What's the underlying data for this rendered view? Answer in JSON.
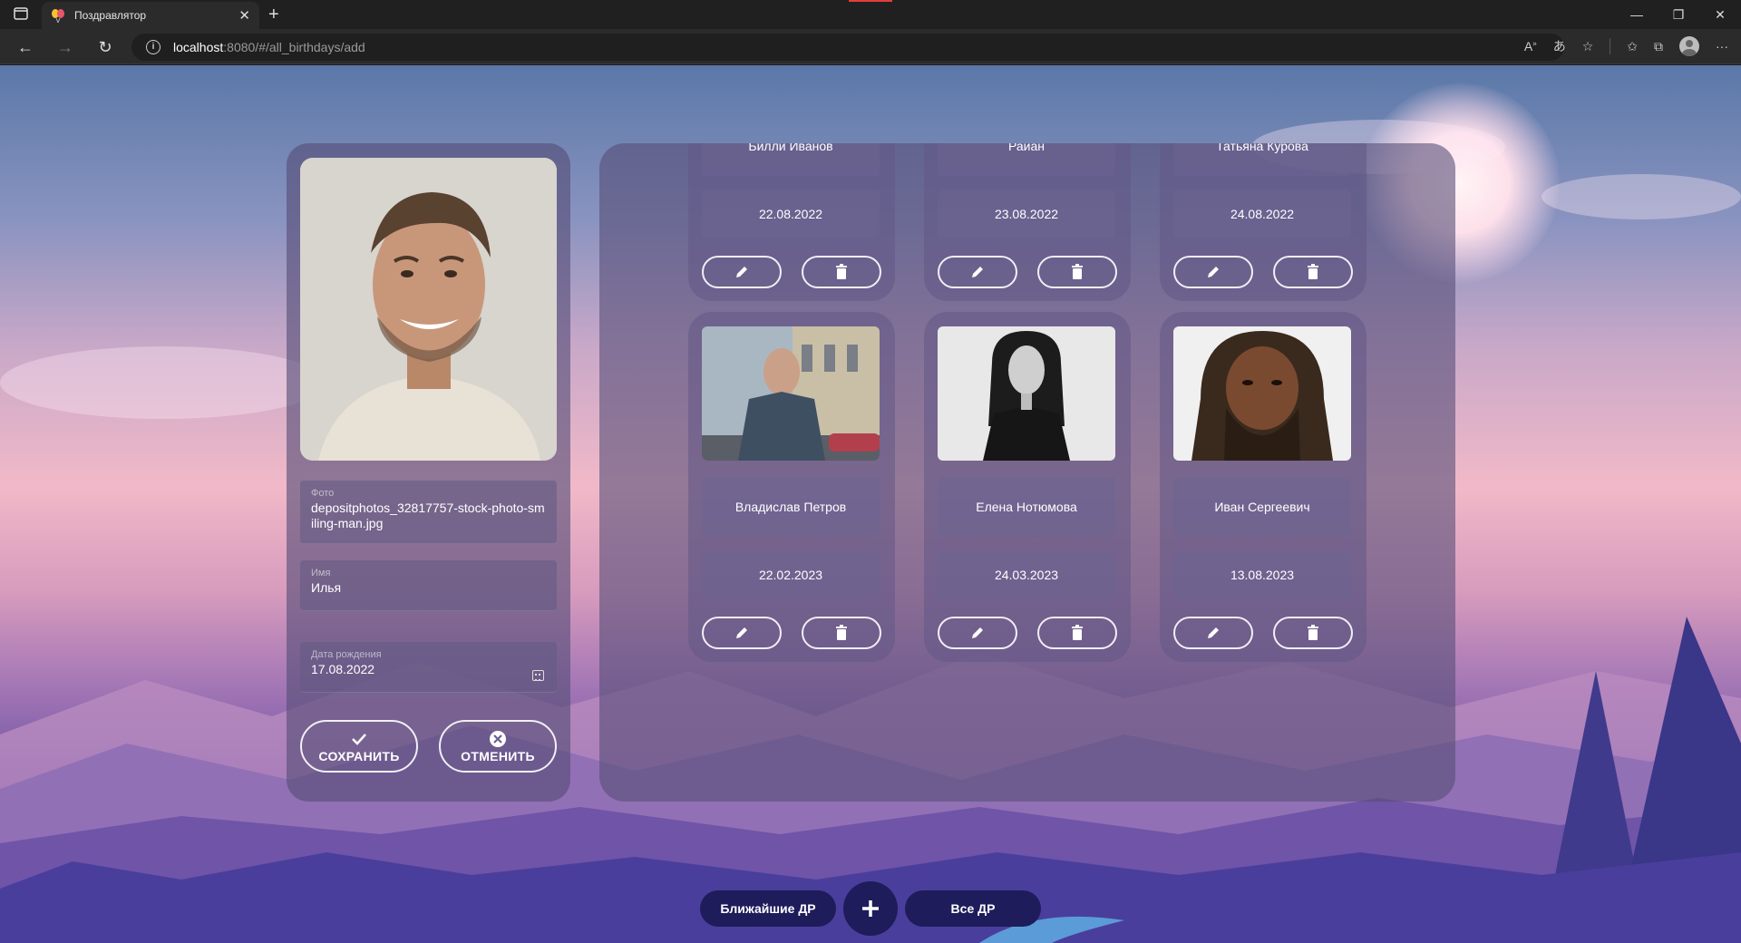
{
  "browser": {
    "tab_title": "Поздравлятор",
    "url_host": "localhost",
    "url_path": ":8080/#/all_birthdays/add"
  },
  "editor": {
    "photo_label": "Фото",
    "photo_value": "depositphotos_32817757-stock-photo-smiling-man.jpg",
    "name_label": "Имя",
    "name_value": "Илья",
    "date_label": "Дата рождения",
    "date_value": "17.08.2022",
    "save_label": "СОХРАНИТЬ",
    "cancel_label": "ОТМЕНИТЬ"
  },
  "cards": [
    {
      "name": "Билли Иванов",
      "date": "22.08.2022"
    },
    {
      "name": "Райан",
      "date": "23.08.2022"
    },
    {
      "name": "Татьяна Курова",
      "date": "24.08.2022"
    },
    {
      "name": "Владислав Петров",
      "date": "22.02.2023"
    },
    {
      "name": "Елена Нотюмова",
      "date": "24.03.2023"
    },
    {
      "name": "Иван Сергеевич",
      "date": "13.08.2023"
    }
  ],
  "bottom_nav": {
    "nearest_label": "Ближайшие ДР",
    "all_label": "Все ДР"
  },
  "colors": {
    "panel": "#564e78",
    "nav_pill": "#1e1c5a",
    "accent_red": "#e23d3d"
  }
}
